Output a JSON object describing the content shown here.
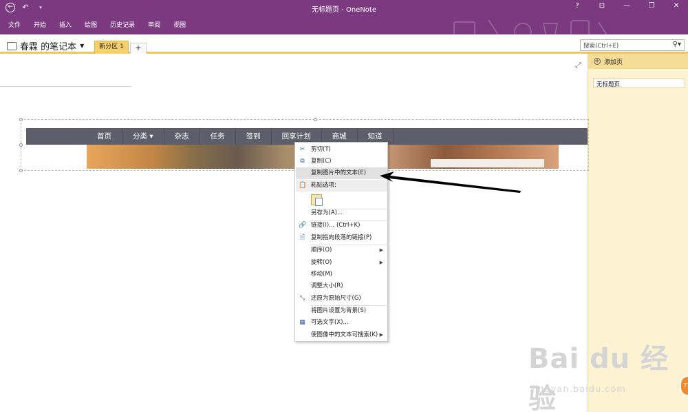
{
  "window": {
    "title": "无标题页 - OneNote",
    "controls": [
      "?",
      "⊡",
      "—",
      "❐",
      "✕"
    ]
  },
  "quick_access": {
    "back_icon": "back-icon",
    "undo_icon": "undo-icon",
    "customize_icon": "customize-icon"
  },
  "ribbon": {
    "tabs": [
      "文件",
      "开始",
      "插入",
      "绘图",
      "历史记录",
      "审阅",
      "视图"
    ],
    "color": "#7b3a7f"
  },
  "notebook": {
    "name": "春霖 的笔记本",
    "section_tab": "新分区 1",
    "add_section": "+",
    "search_placeholder": "搜索(Ctrl+E)"
  },
  "pages_panel": {
    "add_page": "添加页",
    "pages": [
      "无标题页"
    ],
    "background": "#fdf3d2"
  },
  "web_image": {
    "nav_items": [
      "首页",
      "分类",
      "杂志",
      "任务",
      "签到",
      "回享计划",
      "商城",
      "知道"
    ]
  },
  "context_menu": {
    "items": [
      {
        "label": "剪切(T)",
        "icon": "scissors-icon"
      },
      {
        "label": "复制(C)",
        "icon": "copy-icon"
      },
      {
        "label": "复制图片中的文本(E)",
        "icon": "",
        "highlighted": true
      },
      {
        "label": "粘贴选项:",
        "icon": "clipboard-icon",
        "header": true
      },
      {
        "label": "另存为(A)...",
        "icon": ""
      },
      {
        "label": "链接(I)...    (Ctrl+K)",
        "icon": "link-icon"
      },
      {
        "label": "复制指向段落的链接(P)",
        "icon": "link-paragraph-icon"
      },
      {
        "label": "顺序(O)",
        "icon": "",
        "submenu": true
      },
      {
        "label": "旋转(O)",
        "icon": "",
        "submenu": true
      },
      {
        "label": "移动(M)",
        "icon": ""
      },
      {
        "label": "调整大小(R)",
        "icon": ""
      },
      {
        "label": "还原为原始尺寸(G)",
        "icon": "restore-size-icon"
      },
      {
        "label": "将图片设置为背景(S)",
        "icon": ""
      },
      {
        "label": "可选文字(X)...",
        "icon": "alt-text-icon"
      },
      {
        "label": "使图像中的文本可搜索(K)",
        "icon": "",
        "submenu": true
      }
    ]
  },
  "watermark": {
    "text": "Bai du 经验",
    "url_text": "jingyan.baidu.com"
  }
}
